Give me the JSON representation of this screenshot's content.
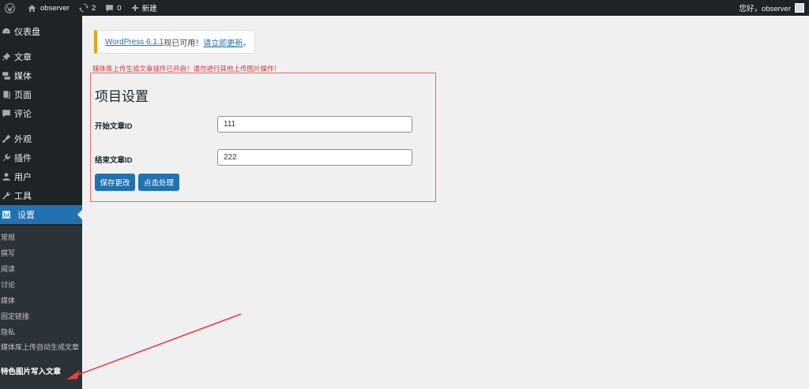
{
  "adminbar": {
    "site_name": "observer",
    "updates_count": "2",
    "comments_count": "0",
    "new_label": "新建",
    "greeting": "您好，observer",
    "icons": [
      "wordpress-icon",
      "home-icon",
      "updates-icon",
      "comment-icon",
      "plus-icon"
    ]
  },
  "sidebar": {
    "items": [
      {
        "label": "仪表盘",
        "icon": "dashboard-icon"
      },
      {
        "label": "文章",
        "icon": "pin-icon"
      },
      {
        "label": "媒体",
        "icon": "media-icon"
      },
      {
        "label": "页面",
        "icon": "page-icon"
      },
      {
        "label": "评论",
        "icon": "comment-icon"
      },
      {
        "label": "外观",
        "icon": "brush-icon"
      },
      {
        "label": "插件",
        "icon": "plugin-icon"
      },
      {
        "label": "用户",
        "icon": "user-icon"
      },
      {
        "label": "工具",
        "icon": "wrench-icon"
      },
      {
        "label": "设置",
        "icon": "settings-icon",
        "active": true
      }
    ],
    "submenu": [
      "常规",
      "撰写",
      "阅读",
      "讨论",
      "媒体",
      "固定链接",
      "隐私",
      "媒体库上传自动生成文章",
      "特色图片写入文章"
    ]
  },
  "notice": {
    "version_link": "WordPress 6.1.1",
    "text": "现已可用！",
    "update_link": "请立即更新",
    "end": "。"
  },
  "warning": "媒体库上传生成文章插件已开启！请勿进行其他上传图片操作！",
  "settings": {
    "title": "项目设置",
    "start_label": "开始文章ID",
    "start_value": "111",
    "end_label": "结束文章ID",
    "end_value": "222",
    "save_label": "保存更改",
    "process_label": "点击处理"
  },
  "colors": {
    "adminbar_bg": "#1d2327",
    "sidebar_bg": "#1d2327",
    "submenu_bg": "#2c3338",
    "accent": "#2271b1",
    "warning": "#d63638",
    "notice_border": "#dba617",
    "box_border": "#e26a6a"
  }
}
